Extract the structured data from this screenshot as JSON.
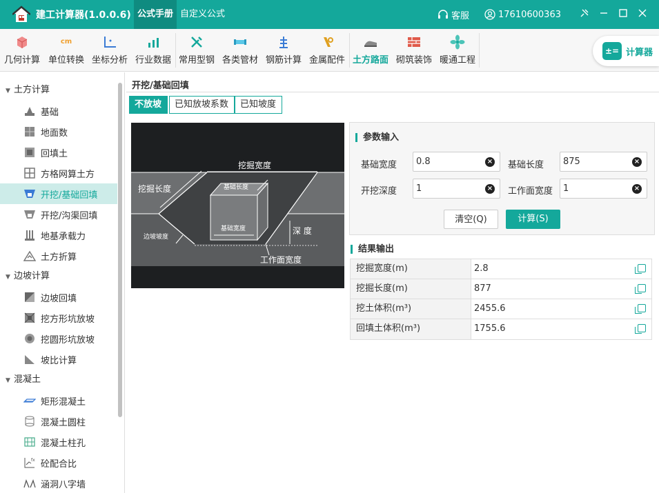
{
  "app": {
    "title": "建工计算器(1.0.0.6)"
  },
  "top_tabs": [
    {
      "label": "公式手册"
    },
    {
      "label": "自定义公式"
    }
  ],
  "header_right": {
    "service": "客服",
    "phone": "17610600363"
  },
  "toolbar": {
    "items": [
      {
        "label": "几何计算"
      },
      {
        "label": "单位转换"
      },
      {
        "label": "坐标分析"
      },
      {
        "label": "行业数据"
      },
      {
        "label": "常用型钢"
      },
      {
        "label": "各类管材"
      },
      {
        "label": "钢筋计算"
      },
      {
        "label": "金属配件"
      },
      {
        "label": "土方路面"
      },
      {
        "label": "砌筑装饰"
      },
      {
        "label": "暖通工程"
      }
    ],
    "calculator_label": "计算器",
    "unit_icon_text": "cm"
  },
  "sidebar": {
    "groups": [
      {
        "label": "土方计算",
        "items": [
          {
            "label": "基础"
          },
          {
            "label": "地面数"
          },
          {
            "label": "回填土"
          },
          {
            "label": "方格网算土方"
          },
          {
            "label": "开挖/基础回填"
          },
          {
            "label": "开挖/沟渠回填"
          },
          {
            "label": "地基承载力"
          },
          {
            "label": "土方折算"
          }
        ]
      },
      {
        "label": "边坡计算",
        "items": [
          {
            "label": "边坡回填"
          },
          {
            "label": "挖方形坑放坡"
          },
          {
            "label": "挖圆形坑放坡"
          },
          {
            "label": "坡比计算"
          }
        ]
      },
      {
        "label": "混凝土",
        "items": [
          {
            "label": "矩形混凝土"
          },
          {
            "label": "混凝土圆柱"
          },
          {
            "label": "混凝土柱孔"
          },
          {
            "label": "砼配合比"
          },
          {
            "label": "涵洞八字墙"
          }
        ]
      }
    ]
  },
  "main": {
    "title": "开挖/基础回填",
    "modes": [
      {
        "label": "不放坡"
      },
      {
        "label": "已知放坡系数"
      },
      {
        "label": "已知坡度"
      }
    ],
    "diagram": {
      "excavation_width": "挖掘宽度",
      "excavation_length": "挖掘长度",
      "base_length": "基础长度",
      "base_width": "基础宽度",
      "slope": "边坡坡度",
      "depth": "深 度",
      "work_width": "工作面宽度"
    },
    "params": {
      "title": "参数输入",
      "fields": [
        {
          "label": "基础宽度",
          "value": "0.8"
        },
        {
          "label": "基础长度",
          "value": "875"
        },
        {
          "label": "开挖深度",
          "value": "1"
        },
        {
          "label": "工作面宽度",
          "value": "1"
        }
      ],
      "clear_label": "清空(Q)",
      "calc_label": "计算(S)"
    },
    "results": {
      "title": "结果输出",
      "rows": [
        {
          "label": "挖掘宽度(m)",
          "value": "2.8"
        },
        {
          "label": "挖掘长度(m)",
          "value": "877"
        },
        {
          "label": "挖土体积(m³)",
          "value": "2455.6"
        },
        {
          "label": "回填土体积(m³)",
          "value": "1755.6"
        }
      ]
    }
  }
}
